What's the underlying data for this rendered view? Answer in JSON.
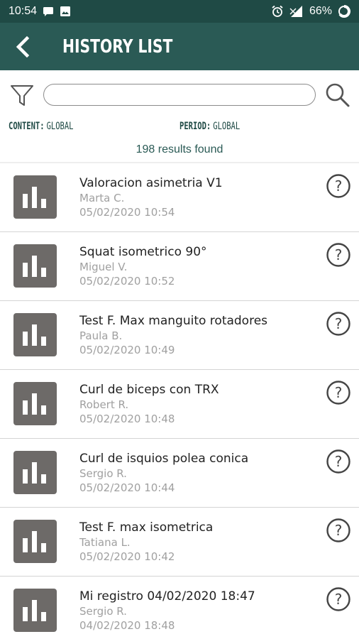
{
  "status_bar": {
    "time": "10:54",
    "battery": "66%",
    "icons": [
      "message-icon",
      "image-icon",
      "alarm-icon",
      "signal-icon",
      "battery-icon"
    ]
  },
  "header": {
    "title": "HISTORY LIST",
    "back_icon": "chevron-left-icon",
    "background": "#2a5a55"
  },
  "search": {
    "value": "",
    "placeholder": "",
    "filter_icon": "filter-icon",
    "search_icon": "search-icon"
  },
  "filters": {
    "content_label": "CONTENT:",
    "content_value": "GLOBAL",
    "period_label": "PERIOD:",
    "period_value": "GLOBAL"
  },
  "results_text": "198 results found",
  "items": [
    {
      "title": "Valoracion asimetria V1",
      "user": "Marta C.",
      "date": "05/02/2020 10:54"
    },
    {
      "title": "Squat isometrico 90°",
      "user": "Miguel V.",
      "date": "05/02/2020 10:52"
    },
    {
      "title": "Test F. Max manguito rotadores",
      "user": "Paula B.",
      "date": "05/02/2020 10:49"
    },
    {
      "title": "Curl de biceps con TRX",
      "user": "Robert R.",
      "date": "05/02/2020 10:48"
    },
    {
      "title": "Curl de isquios polea conica",
      "user": "Sergio R.",
      "date": "05/02/2020 10:44"
    },
    {
      "title": "Test F. max isometrica",
      "user": "Tatiana L.",
      "date": "05/02/2020 10:42"
    },
    {
      "title": "Mi registro 04/02/2020 18:47",
      "user": "Sergio R.",
      "date": "04/02/2020 18:48"
    }
  ],
  "colors": {
    "accent": "#2a5a55",
    "status_bar": "#1f4a45",
    "thumb": "#6d6a68"
  }
}
